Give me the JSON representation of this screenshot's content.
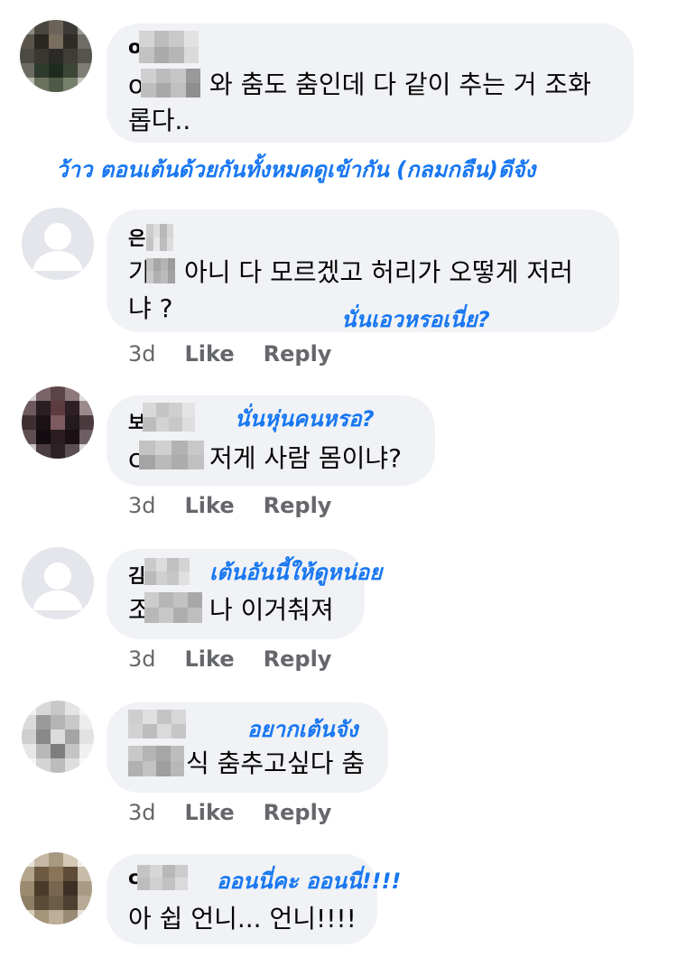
{
  "comments": [
    {
      "name_initial": "o",
      "text_lead": "o",
      "text": "와 춤도 춤인데 다 같이 추는 거 조화",
      "text_line2": "롭다..",
      "annotation": "ว้าว ตอนเต้นด้วยกันทั้งหมดดูเข้ากัน (กลมกลืน)ดีจัง"
    },
    {
      "name_initial": "은",
      "text_lead": "가",
      "text": "아니 다 모르겠고 허리가 오떻게 저러",
      "text_line2": "냐 ?",
      "annotation": "นั่นเอวหรอเนี่ย?",
      "time": "3d",
      "like": "Like",
      "reply": "Reply"
    },
    {
      "name_initial": "보",
      "text_lead": "c",
      "text": "저게 사람 몸이냐?",
      "annotation": "นั่นหุ่นคนหรอ?",
      "time": "3d",
      "like": "Like",
      "reply": "Reply"
    },
    {
      "name_initial": "김",
      "text_lead": "조",
      "text": "나 이거춰져",
      "annotation": "เต้นอันนี้ให้ดูหน่อย",
      "time": "3d",
      "like": "Like",
      "reply": "Reply"
    },
    {
      "text": "식 춤추고싶다 춤",
      "annotation": "อยากเต้นจัง",
      "time": "3d",
      "like": "Like",
      "reply": "Reply"
    },
    {
      "name_initial": "c",
      "text": "아 쉽 언니... 언니!!!!",
      "annotation": "ออนนี่คะ ออนนี่!!!!"
    }
  ],
  "colors": {
    "bubble": "#f0f2f5",
    "annotation": "#1877f2",
    "meta": "#65676b"
  }
}
